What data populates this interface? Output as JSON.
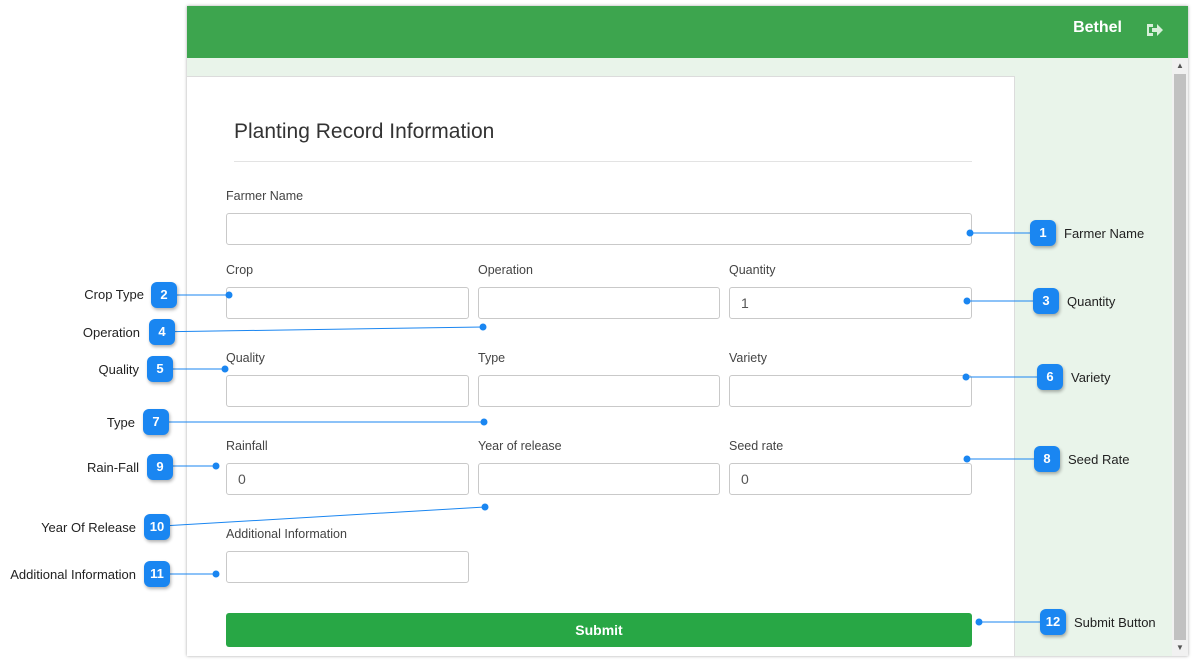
{
  "header": {
    "user_name": "Bethel",
    "logout_icon": "logout-icon",
    "bg_color": "#3da54e"
  },
  "form": {
    "title": "Planting Record Information",
    "farmer_name_label": "Farmer Name",
    "farmer_name_value": "",
    "crop_label": "Crop",
    "crop_value": "",
    "operation_label": "Operation",
    "operation_value": "",
    "quantity_label": "Quantity",
    "quantity_value": "1",
    "quality_label": "Quality",
    "quality_value": "",
    "type_label": "Type",
    "type_value": "",
    "variety_label": "Variety",
    "variety_value": "",
    "rainfall_label": "Rainfall",
    "rainfall_value": "0",
    "year_label": "Year of release",
    "year_value": "",
    "seed_rate_label": "Seed rate",
    "seed_rate_value": "0",
    "additional_label": "Additional Information",
    "additional_value": "",
    "submit_label": "Submit",
    "submit_color": "#28a745"
  },
  "callouts": [
    {
      "num": "1",
      "text": "Farmer Name"
    },
    {
      "num": "2",
      "text": "Crop Type"
    },
    {
      "num": "3",
      "text": "Quantity"
    },
    {
      "num": "4",
      "text": "Operation"
    },
    {
      "num": "5",
      "text": "Quality"
    },
    {
      "num": "6",
      "text": "Variety"
    },
    {
      "num": "7",
      "text": "Type"
    },
    {
      "num": "8",
      "text": "Seed Rate"
    },
    {
      "num": "9",
      "text": "Rain-Fall"
    },
    {
      "num": "10",
      "text": "Year Of Release"
    },
    {
      "num": "11",
      "text": "Additional Information"
    },
    {
      "num": "12",
      "text": "Submit Button"
    }
  ],
  "callout_color": "#1a86f1"
}
